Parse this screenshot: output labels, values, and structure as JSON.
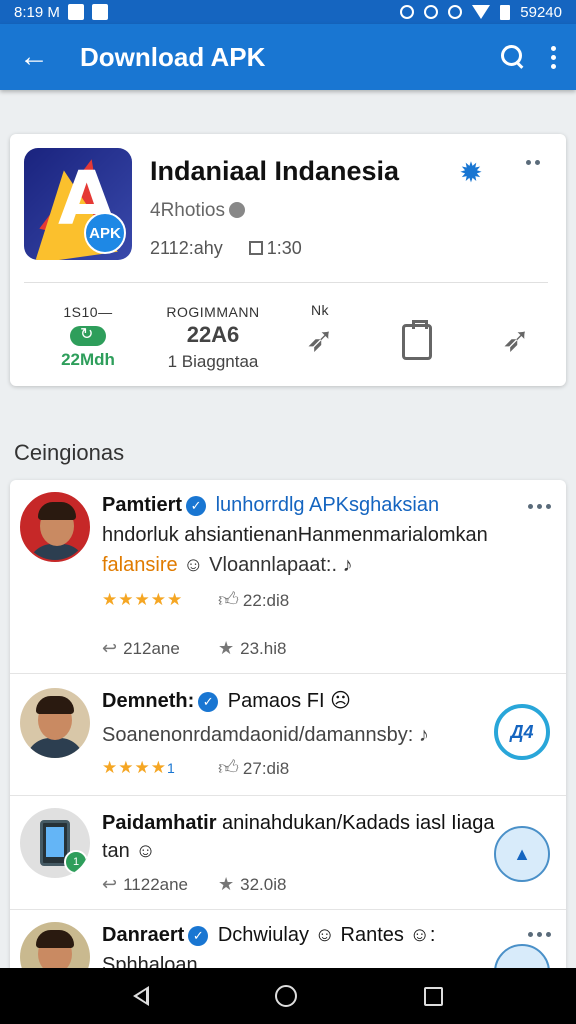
{
  "status_bar": {
    "time": "8:19 M",
    "right_text": "59240"
  },
  "app_bar": {
    "title": "Download APK"
  },
  "app": {
    "name": "Indaniaal Indanesia",
    "icon_badge": "APK",
    "developer": "4Rhotios",
    "line2a": "2112:ahy",
    "line2b": "1:30"
  },
  "stats": {
    "col1_top": "1S10—",
    "col1_bottom": "22Mdh",
    "col2_top": "ROGIMMANN",
    "col2_big": "22A6",
    "col2_bottom": "1 Biaggntaa",
    "col3_top": "Nk"
  },
  "section": {
    "title": "Ceingionas"
  },
  "reviews": [
    {
      "name": "Pamtiert",
      "link": "lunhorrdlg APKsghaksian",
      "line2": "hndorluk ahsiantienanHanmenmarialomkan",
      "line3_orange": "falansire",
      "line3_rest": "Vloannlapaat:.",
      "stars": "★★★★★",
      "likes": "22:di8",
      "replies": "212ane",
      "score": "23.hi8"
    },
    {
      "name": "Demneth:",
      "link": "Pamaos FI",
      "line2": "Soanenonrdamdaonid/damannsby:",
      "stars": "★★★★",
      "stars_extra": "1",
      "likes": "27:di8",
      "badge": "Д4"
    },
    {
      "name": "Paidamhatir",
      "line1_rest": "aninahdukan/Kadads iasl Iiaga",
      "line2": "tan",
      "replies": "1122ane",
      "score": "32.0i8",
      "phone_badge": "1"
    },
    {
      "name": "Danraert",
      "link": "Dchwiulay",
      "line1_rest": "Rantes",
      "line2": "Sphhaloan"
    }
  ],
  "colors": {
    "primary": "#1976d2",
    "status": "#1565c0",
    "green": "#2e9e5b",
    "star": "#f5a623"
  }
}
